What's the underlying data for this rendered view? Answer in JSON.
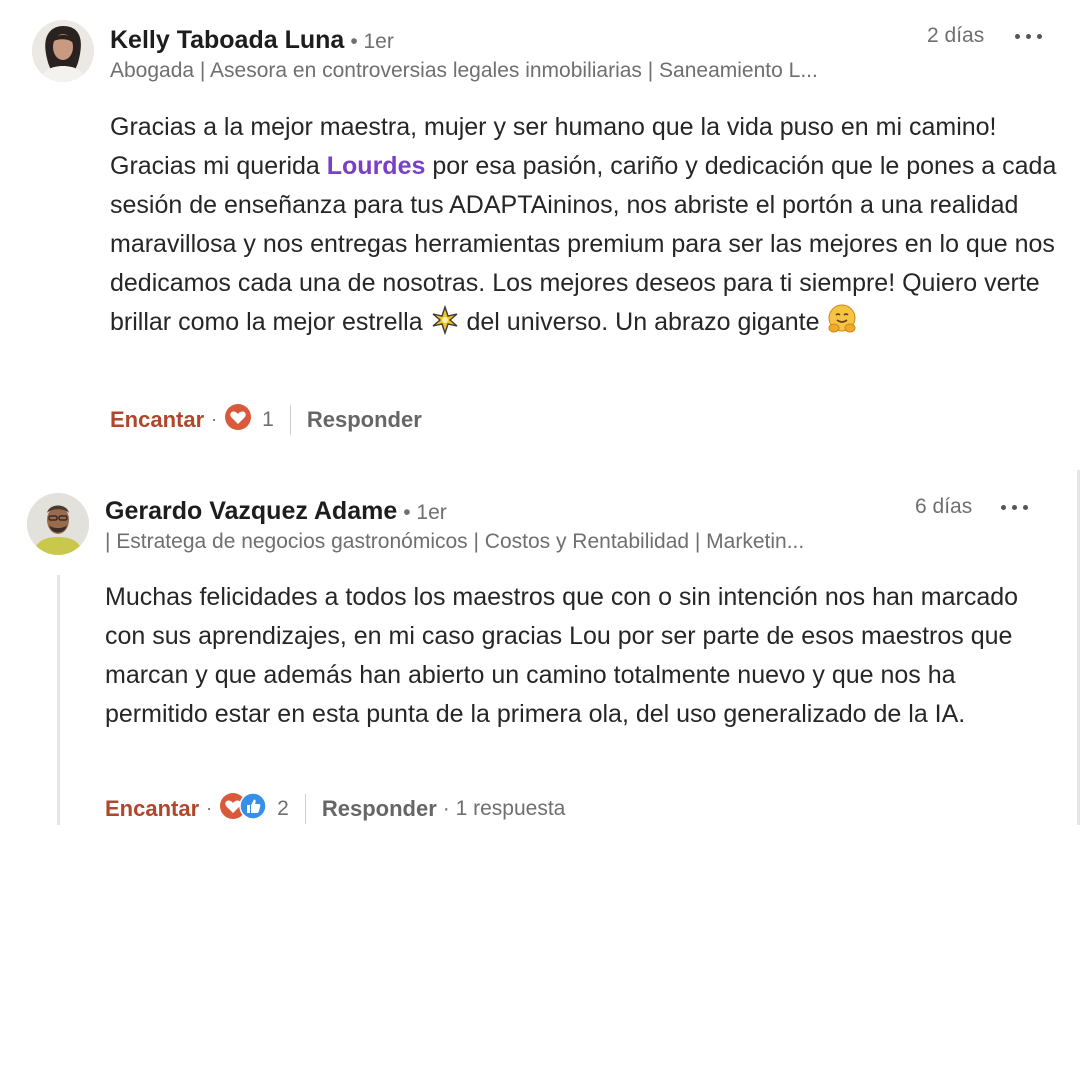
{
  "comments": [
    {
      "author": "Kelly Taboada Luna",
      "degree": "• 1er",
      "headline": "Abogada | Asesora en controversias legales inmobiliarias | Saneamiento L...",
      "time": "2 días",
      "text_parts": [
        "Gracias a la mejor maestra, mujer y ser humano que la vida puso en mi camino! Gracias mi querida ",
        "Lourdes",
        " por esa pasión, cariño y dedicación que le pones a cada sesión de enseñanza para tus ADAPTAininos, nos abriste el portón a una realidad maravillosa y nos entregas herramientas premium para ser las mejores en lo que nos dedicamos cada una de nosotras. Los mejores deseos para ti siempre! Quiero verte brillar como la mejor estrella ",
        " del universo. Un abrazo gigante "
      ],
      "emojis": [
        "sparkle-star-icon",
        "hugging-face-icon"
      ],
      "like_label": "Encantar",
      "separator": "·",
      "reaction_icons": [
        "love-reaction-icon"
      ],
      "reaction_count": "1",
      "reply_label": "Responder"
    },
    {
      "author": "Gerardo Vazquez Adame",
      "degree": "• 1er",
      "headline": "| Estratega de negocios gastronómicos | Costos y Rentabilidad | Marketin...",
      "time": "6 días",
      "text": "Muchas felicidades a todos los maestros que con o sin intención nos han marcado con sus aprendizajes, en mi caso gracias Lou por ser parte de esos maestros que marcan y que además han abierto un camino totalmente nuevo y que nos ha permitido estar en esta punta de la primera ola, del uso generalizado de la IA.",
      "like_label": "Encantar",
      "separator": "·",
      "reaction_icons": [
        "love-reaction-icon",
        "like-reaction-icon"
      ],
      "reaction_count": "2",
      "reply_label": "Responder",
      "replies_label": "· 1 respuesta"
    }
  ],
  "colors": {
    "like_accent": "#b0462b",
    "mention": "#7a3fc5",
    "muted": "#6f6f6f",
    "love": "#d9593a",
    "like_blue": "#378fe9"
  }
}
